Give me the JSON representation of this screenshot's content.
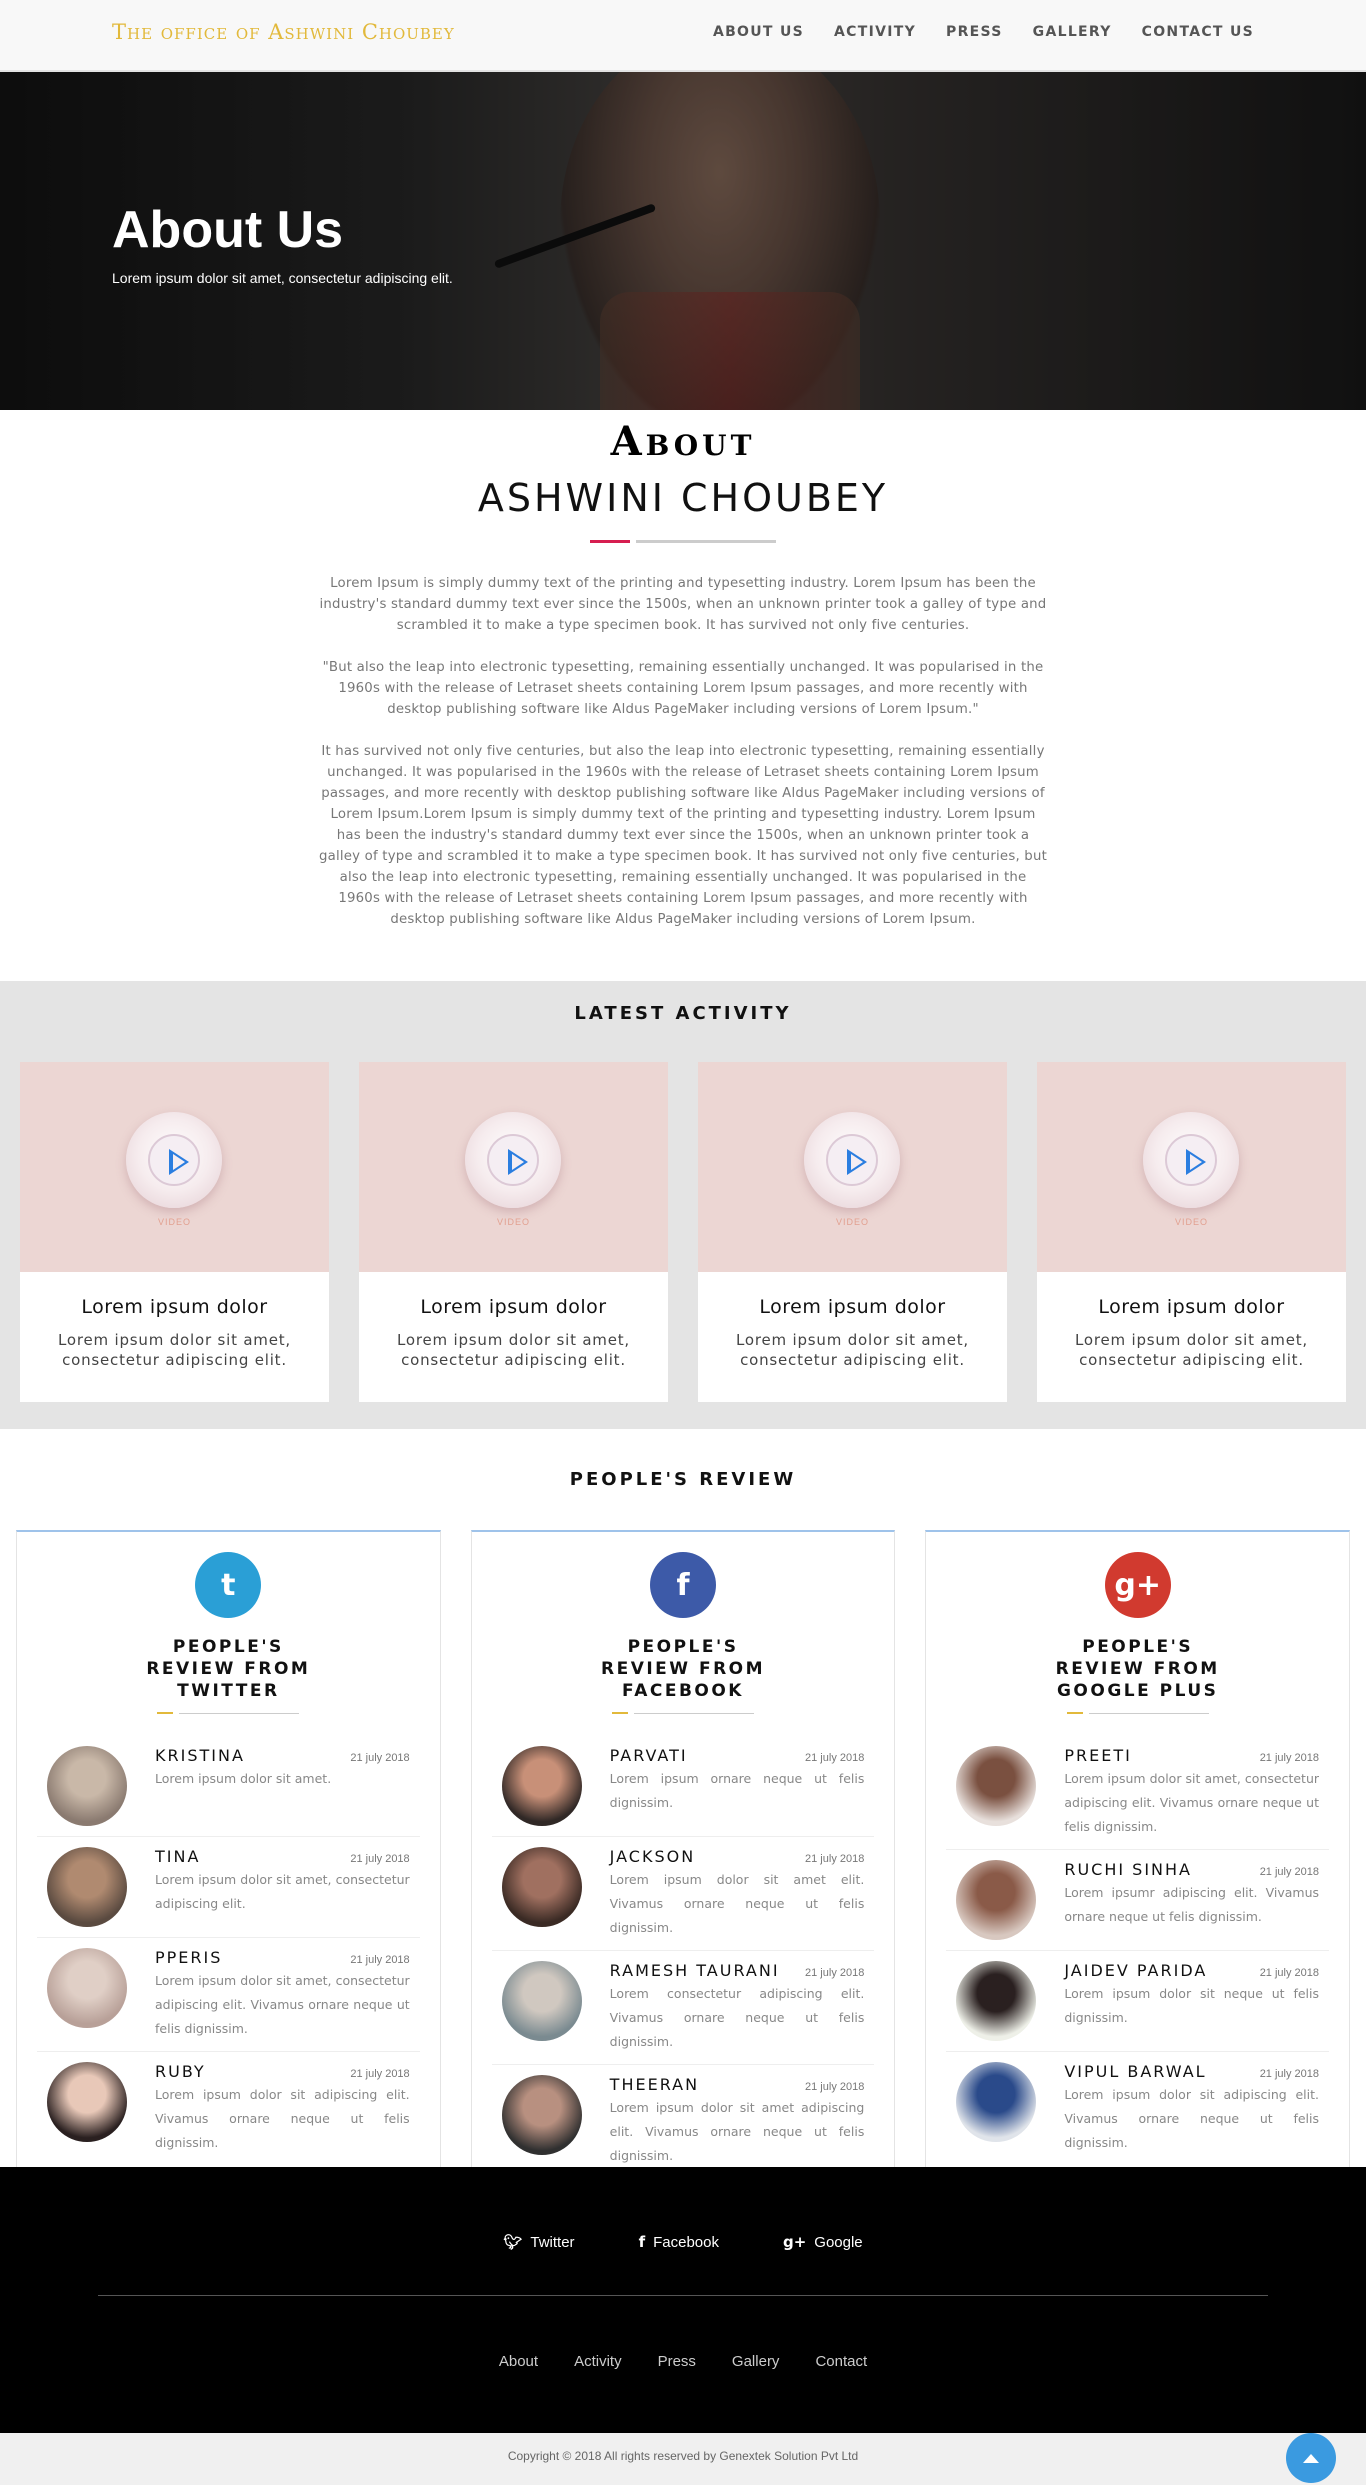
{
  "nav": {
    "brand": "The office of Ashwini Choubey",
    "items": [
      "ABOUT US",
      "ACTIVITY",
      "PRESS",
      "GALLERY",
      "CONTACT US"
    ]
  },
  "hero": {
    "title": "About Us",
    "subtitle": "Lorem ipsum dolor sit amet, consectetur adipiscing elit."
  },
  "about": {
    "heading": "About",
    "name": "ASHWINI CHOUBEY",
    "paragraphs": [
      "Lorem Ipsum is simply dummy text of the printing and typesetting industry. Lorem Ipsum has been the industry's standard dummy text ever since the 1500s, when an unknown printer took a galley of type and scrambled it to make a type specimen book. It has survived not only five centuries.",
      "\"But also the leap into electronic typesetting, remaining essentially unchanged. It was popularised in the 1960s with the release of Letraset sheets containing Lorem Ipsum passages, and more recently with desktop publishing software like Aldus PageMaker including versions of Lorem Ipsum.\"",
      "It has survived not only five centuries, but also the leap into electronic typesetting, remaining essentially unchanged. It was popularised in the 1960s with the release of Letraset sheets containing Lorem Ipsum passages, and more recently with desktop publishing software like Aldus PageMaker including versions of Lorem Ipsum.Lorem Ipsum is simply dummy text of the printing and typesetting industry. Lorem Ipsum has been the industry's standard dummy text ever since the 1500s, when an unknown printer took a galley of type and scrambled it to make a type specimen book. It has survived not only five centuries, but also the leap into electronic typesetting, remaining essentially unchanged. It was popularised in the 1960s with the release of Letraset sheets containing Lorem Ipsum passages, and more recently with desktop publishing software like Aldus PageMaker including versions of Lorem Ipsum."
    ]
  },
  "activity": {
    "title": "LATEST ACTIVITY",
    "video_label": "VIDEO",
    "cards": [
      {
        "title": "Lorem ipsum dolor",
        "text": "Lorem ipsum dolor sit amet, consectetur adipiscing elit."
      },
      {
        "title": "Lorem ipsum dolor",
        "text": "Lorem ipsum dolor sit amet, consectetur adipiscing elit."
      },
      {
        "title": "Lorem ipsum dolor",
        "text": "Lorem ipsum dolor sit amet, consectetur adipiscing elit."
      },
      {
        "title": "Lorem ipsum dolor",
        "text": "Lorem ipsum dolor sit amet, consectetur adipiscing elit."
      }
    ]
  },
  "reviews": {
    "title": "PEOPLE'S REVIEW",
    "columns": [
      {
        "icon": "twitter-icon",
        "glyph": "t",
        "color": "#2a9fd6",
        "title": "PEOPLE'S REVIEW FROM TWITTER",
        "entries": [
          {
            "name": "KRISTINA",
            "date": "21 july 2018",
            "text": "Lorem ipsum dolor sit amet."
          },
          {
            "name": "TINA",
            "date": "21 july 2018",
            "text": "Lorem ipsum dolor sit amet, consectetur adipiscing elit."
          },
          {
            "name": "PPERIS",
            "date": "21 july 2018",
            "text": "Lorem ipsum dolor sit amet, consectetur adipiscing elit. Vivamus ornare neque ut felis dignissim."
          },
          {
            "name": "RUBY",
            "date": "21 july 2018",
            "text": "Lorem ipsum dolor sit adipiscing elit. Vivamus ornare neque ut felis dignissim."
          }
        ]
      },
      {
        "icon": "facebook-icon",
        "glyph": "f",
        "color": "#3d5aa8",
        "title": "PEOPLE'S REVIEW FROM FACEBOOK",
        "entries": [
          {
            "name": "PARVATI",
            "date": "21 july 2018",
            "text": "Lorem ipsum ornare neque ut felis dignissim."
          },
          {
            "name": "JACKSON",
            "date": "21 july 2018",
            "text": "Lorem ipsum dolor sit amet elit. Vivamus ornare neque ut felis dignissim."
          },
          {
            "name": "RAMESH TAURANI",
            "date": "21 july 2018",
            "text": "Lorem consectetur adipiscing elit. Vivamus ornare neque ut felis dignissim."
          },
          {
            "name": "THEERAN",
            "date": "21 july 2018",
            "text": "Lorem ipsum dolor sit amet adipiscing elit. Vivamus ornare neque ut felis dignissim."
          }
        ]
      },
      {
        "icon": "google-plus-icon",
        "glyph": "g+",
        "color": "#d13a2f",
        "title": "PEOPLE'S REVIEW FROM GOOGLE PLUS",
        "entries": [
          {
            "name": "PREETI",
            "date": "21 july 2018",
            "text": "Lorem ipsum dolor sit amet, consectetur adipiscing elit. Vivamus ornare neque ut felis dignissim."
          },
          {
            "name": "RUCHI SINHA",
            "date": "21 july 2018",
            "text": "Lorem ipsumr adipiscing elit. Vivamus ornare neque ut felis dignissim."
          },
          {
            "name": "JAIDEV PARIDA",
            "date": "21 july 2018",
            "text": "Lorem ipsum dolor sit neque ut felis dignissim."
          },
          {
            "name": "VIPUL BARWAL",
            "date": "21 july 2018",
            "text": "Lorem ipsum dolor sit adipiscing elit. Vivamus ornare neque ut felis dignissim."
          }
        ]
      }
    ]
  },
  "footer": {
    "social": [
      {
        "icon": "twitter-icon",
        "glyph": "t",
        "label": "Twitter"
      },
      {
        "icon": "facebook-icon",
        "glyph": "f",
        "label": "Facebook"
      },
      {
        "icon": "google-plus-icon",
        "glyph": "g+",
        "label": "Google"
      }
    ],
    "links": [
      "About",
      "Activity",
      "Press",
      "Gallery",
      "Contact"
    ],
    "copyright": "Copyright © 2018 All rights reserved by Genextek Solution Pvt Ltd"
  },
  "colors": {
    "brand": "#e2b93b",
    "accent_red": "#d61e50",
    "scroll_top": "#3a9ae0"
  }
}
